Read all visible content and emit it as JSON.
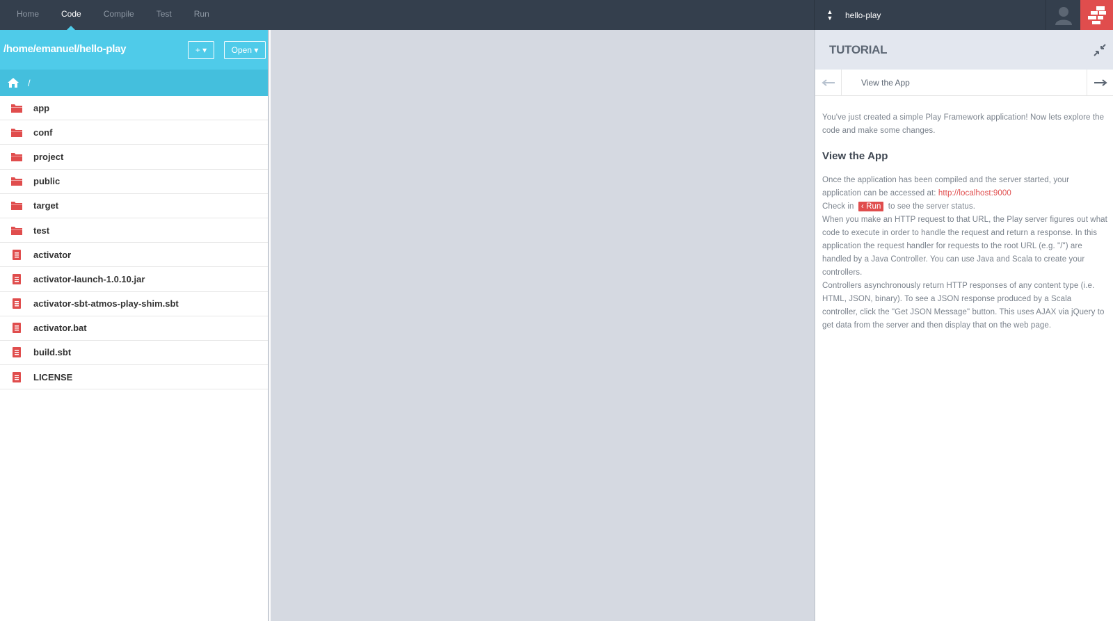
{
  "nav": {
    "items": [
      {
        "label": "Home",
        "active": false
      },
      {
        "label": "Code",
        "active": true
      },
      {
        "label": "Compile",
        "active": false
      },
      {
        "label": "Test",
        "active": false
      },
      {
        "label": "Run",
        "active": false
      }
    ]
  },
  "project": {
    "name": "hello-play"
  },
  "browser": {
    "path": "/home/emanuel/hello-play",
    "add_label": "+ ▾",
    "open_label": "Open ▾",
    "breadcrumb_root": "/",
    "files": [
      {
        "name": "app",
        "type": "folder"
      },
      {
        "name": "conf",
        "type": "folder"
      },
      {
        "name": "project",
        "type": "folder"
      },
      {
        "name": "public",
        "type": "folder"
      },
      {
        "name": "target",
        "type": "folder"
      },
      {
        "name": "test",
        "type": "folder"
      },
      {
        "name": "activator",
        "type": "file"
      },
      {
        "name": "activator-launch-1.0.10.jar",
        "type": "file"
      },
      {
        "name": "activator-sbt-atmos-play-shim.sbt",
        "type": "file"
      },
      {
        "name": "activator.bat",
        "type": "file"
      },
      {
        "name": "build.sbt",
        "type": "file"
      },
      {
        "name": "LICENSE",
        "type": "file"
      }
    ]
  },
  "tutorial": {
    "title": "TUTORIAL",
    "step_title": "View the App",
    "intro": "You've just created a simple Play Framework application! Now lets explore the code and make some changes.",
    "heading": "View the App",
    "p1_text": "Once the application has been compiled and the server started, your application can be accessed at: ",
    "p1_link": "http://localhost:9000",
    "p2_before": "Check in ",
    "p2_badge": "Run",
    "p2_after": " to see the server status.",
    "p3": "When you make an HTTP request to that URL, the Play server figures out what code to execute in order to handle the request and return a response. In this application the request handler for requests to the root URL (e.g. \"/\") are handled by a Java Controller. You can use Java and Scala to create your controllers.",
    "p4": "Controllers asynchronously return HTTP responses of any content type (i.e. HTML, JSON, binary). To see a JSON response produced by a Scala controller, click the \"Get JSON Message\" button. This uses AJAX via jQuery to get data from the server and then display that on the web page."
  },
  "colors": {
    "topbar": "#343f4d",
    "accent_blue": "#4fcbe9",
    "accent_red": "#e04d4d",
    "editor_bg": "#d5d9e1"
  },
  "icons": {
    "folder": "folder-icon",
    "file": "file-icon",
    "home": "home-icon",
    "user": "user-icon",
    "logo": "typesafe-logo-icon"
  }
}
